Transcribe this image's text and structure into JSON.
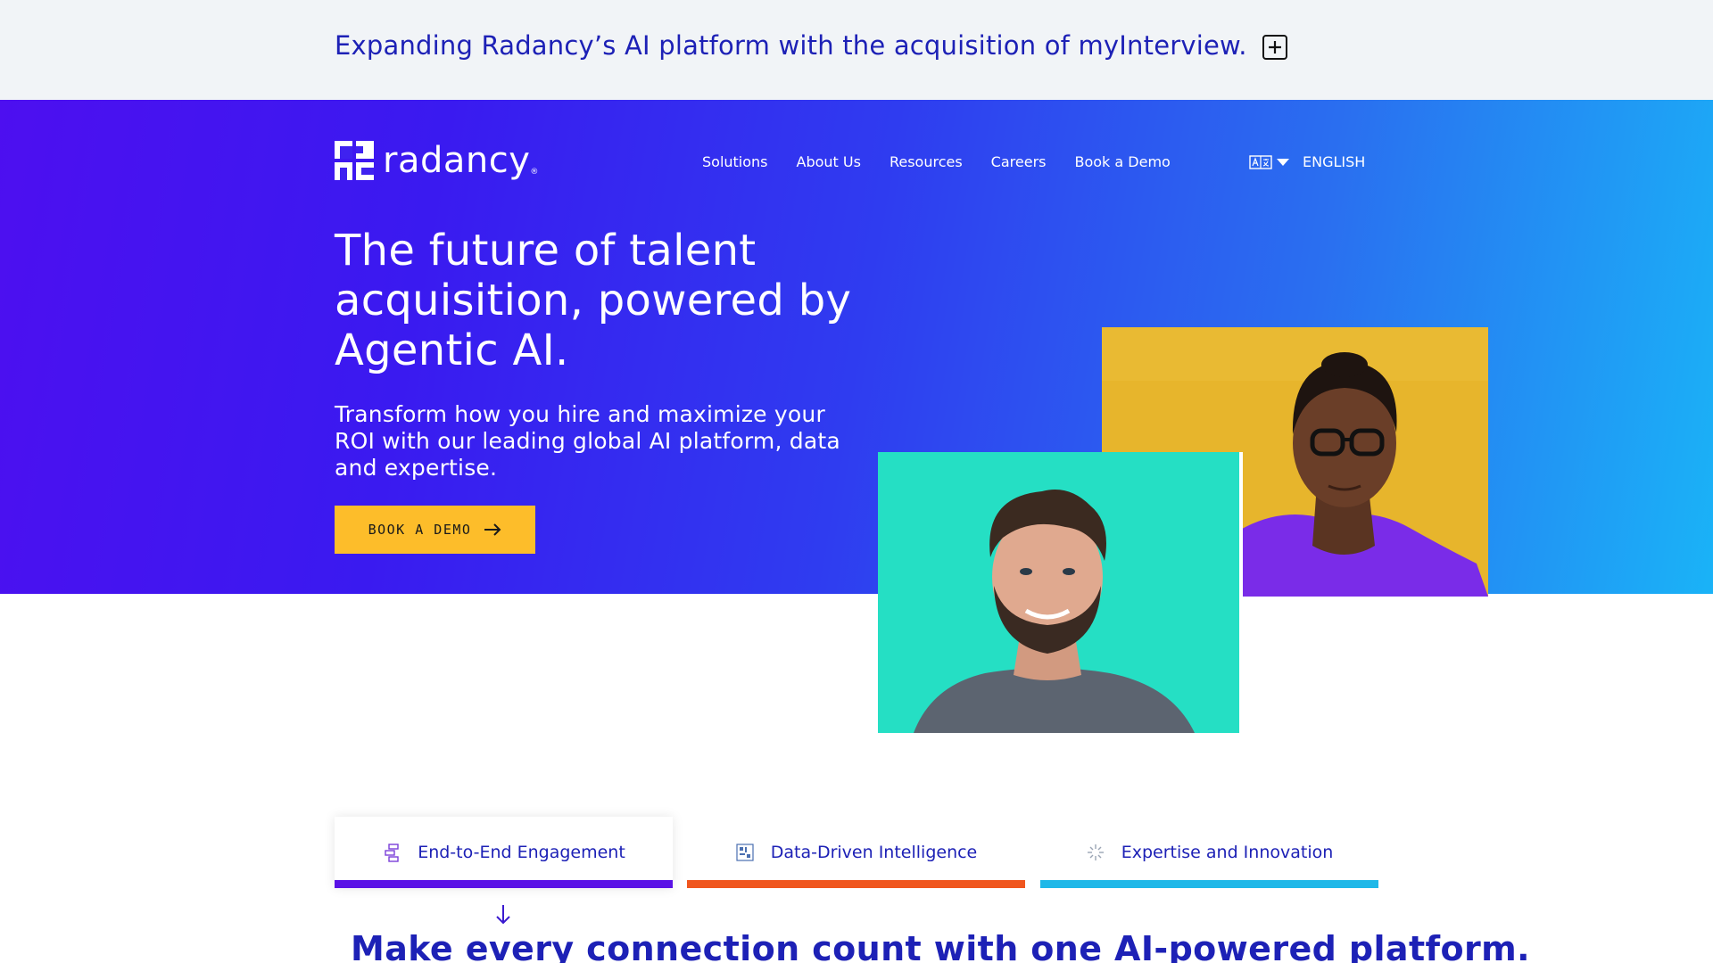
{
  "announcement": {
    "text": "Expanding Radancy’s AI platform with the acquisition of myInterview.",
    "toggle_icon": "plus-square-icon"
  },
  "brand": {
    "name": "radancy",
    "registered": "®"
  },
  "nav": {
    "items": [
      {
        "label": "Solutions"
      },
      {
        "label": "About Us"
      },
      {
        "label": "Resources"
      },
      {
        "label": "Careers"
      },
      {
        "label": "Book a Demo"
      }
    ]
  },
  "language": {
    "icon": "translate-icon",
    "label": "ENGLISH"
  },
  "hero": {
    "headline": "The future of talent acquisition, powered by Agentic AI.",
    "subhead": "Transform how you hire and maximize your ROI with our leading global AI platform, data and expertise.",
    "cta_label": "BOOK A DEMO"
  },
  "tabs": [
    {
      "label": "End-to-End Engagement",
      "icon": "flow-blocks-icon",
      "color": "#5a12e6",
      "active": true
    },
    {
      "label": "Data-Driven Intelligence",
      "icon": "data-grid-icon",
      "color": "#f0561e",
      "active": false
    },
    {
      "label": "Expertise and Innovation",
      "icon": "sparkle-burst-icon",
      "color": "#1fb8e8",
      "active": false
    }
  ],
  "section": {
    "title": "Make every connection count with one AI-powered platform."
  },
  "colors": {
    "cta": "#fdbd2a",
    "brand_blue": "#1d21b6",
    "hero_start": "#4d0ff0",
    "hero_end": "#1ab3f7"
  }
}
